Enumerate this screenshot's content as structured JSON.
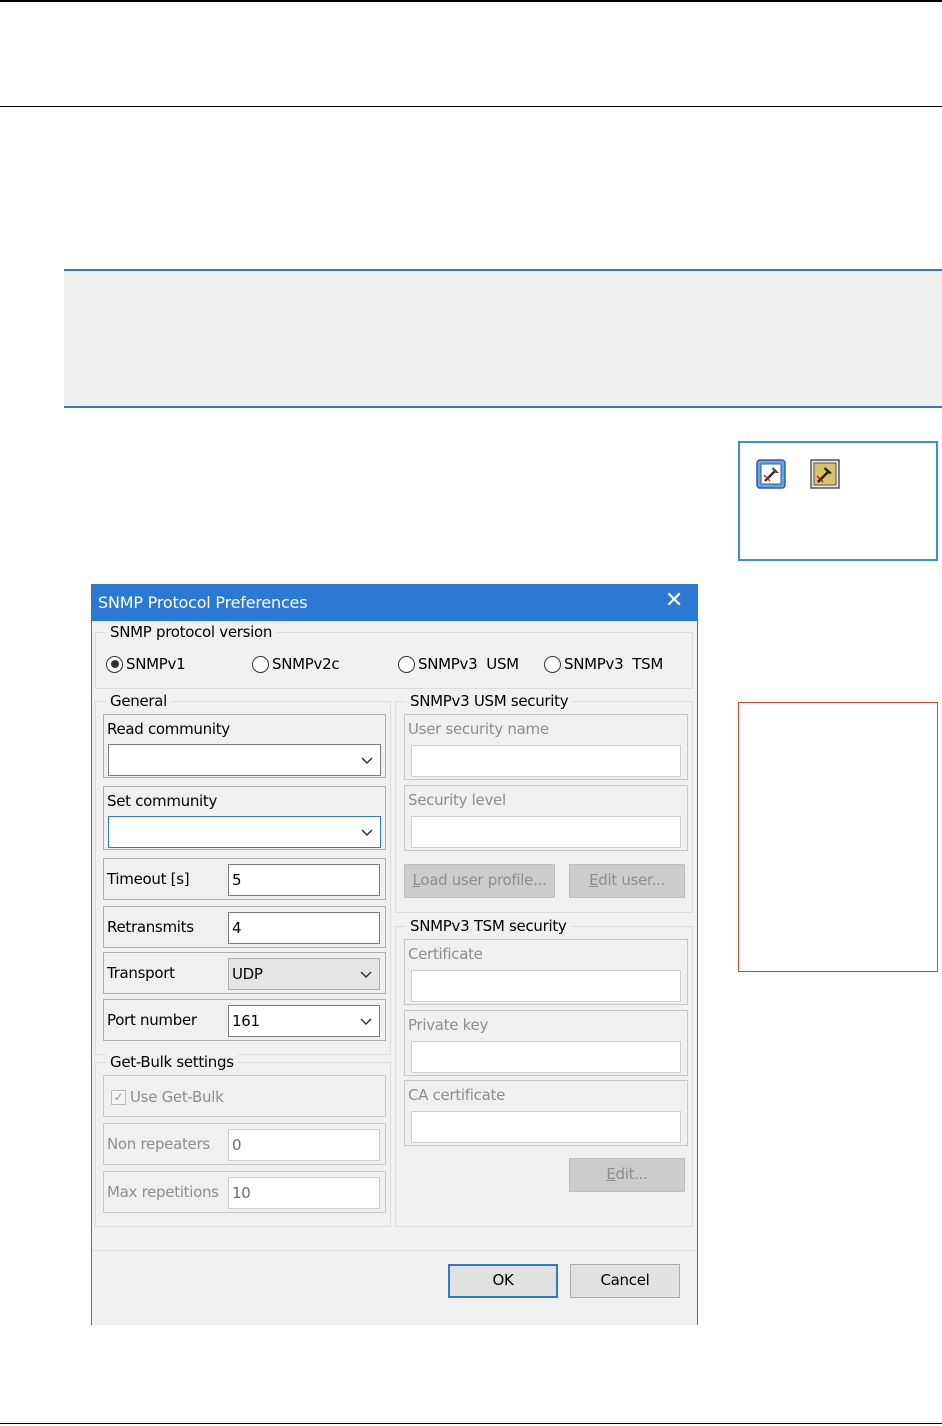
{
  "dialog": {
    "title": "SNMP Protocol Preferences",
    "close_glyph": "✕",
    "version_group": {
      "legend": "SNMP protocol version",
      "options": [
        "SNMPv1",
        "SNMPv2c",
        "SNMPv3  USM",
        "SNMPv3  TSM"
      ],
      "selected": "SNMPv1"
    },
    "general": {
      "legend": "General",
      "read_community": {
        "label": "Read community",
        "value": ""
      },
      "set_community": {
        "label": "Set community",
        "value": ""
      },
      "timeout": {
        "label": "Timeout [s]",
        "value": "5"
      },
      "retransmits": {
        "label": "Retransmits",
        "value": "4"
      },
      "transport": {
        "label": "Transport",
        "value": "UDP"
      },
      "port": {
        "label": "Port number",
        "value": "161"
      }
    },
    "getbulk": {
      "legend": "Get-Bulk settings",
      "use_label": "Use Get-Bulk",
      "use_checked": true,
      "non_repeaters": {
        "label": "Non repeaters",
        "value": "0"
      },
      "max_repetitions": {
        "label": "Max repetitions",
        "value": "10"
      }
    },
    "usm": {
      "legend": "SNMPv3 USM security",
      "user_security_name": {
        "label": "User security name",
        "value": ""
      },
      "security_level": {
        "label": "Security level",
        "value": ""
      },
      "load_profile_mnemonic": "L",
      "load_profile_rest": "oad user profile...",
      "edit_user_mnemonic": "E",
      "edit_user_rest": "dit user..."
    },
    "tsm": {
      "legend": "SNMPv3 TSM security",
      "certificate": {
        "label": "Certificate",
        "value": ""
      },
      "private_key": {
        "label": "Private key",
        "value": ""
      },
      "ca_certificate": {
        "label": "CA certificate",
        "value": ""
      },
      "edit_mnemonic": "E",
      "edit_rest": "dit..."
    },
    "ok_label": "OK",
    "cancel_label": "Cancel"
  },
  "icons": {
    "toolbar_icon_1": "snmp-preferences-icon",
    "toolbar_icon_2": "snmp-preferences-disabled-icon"
  },
  "colors": {
    "accent": "#2b79d3",
    "note_border": "#3877c4",
    "note_bg": "#efefef",
    "red_box": "#d9473b"
  }
}
